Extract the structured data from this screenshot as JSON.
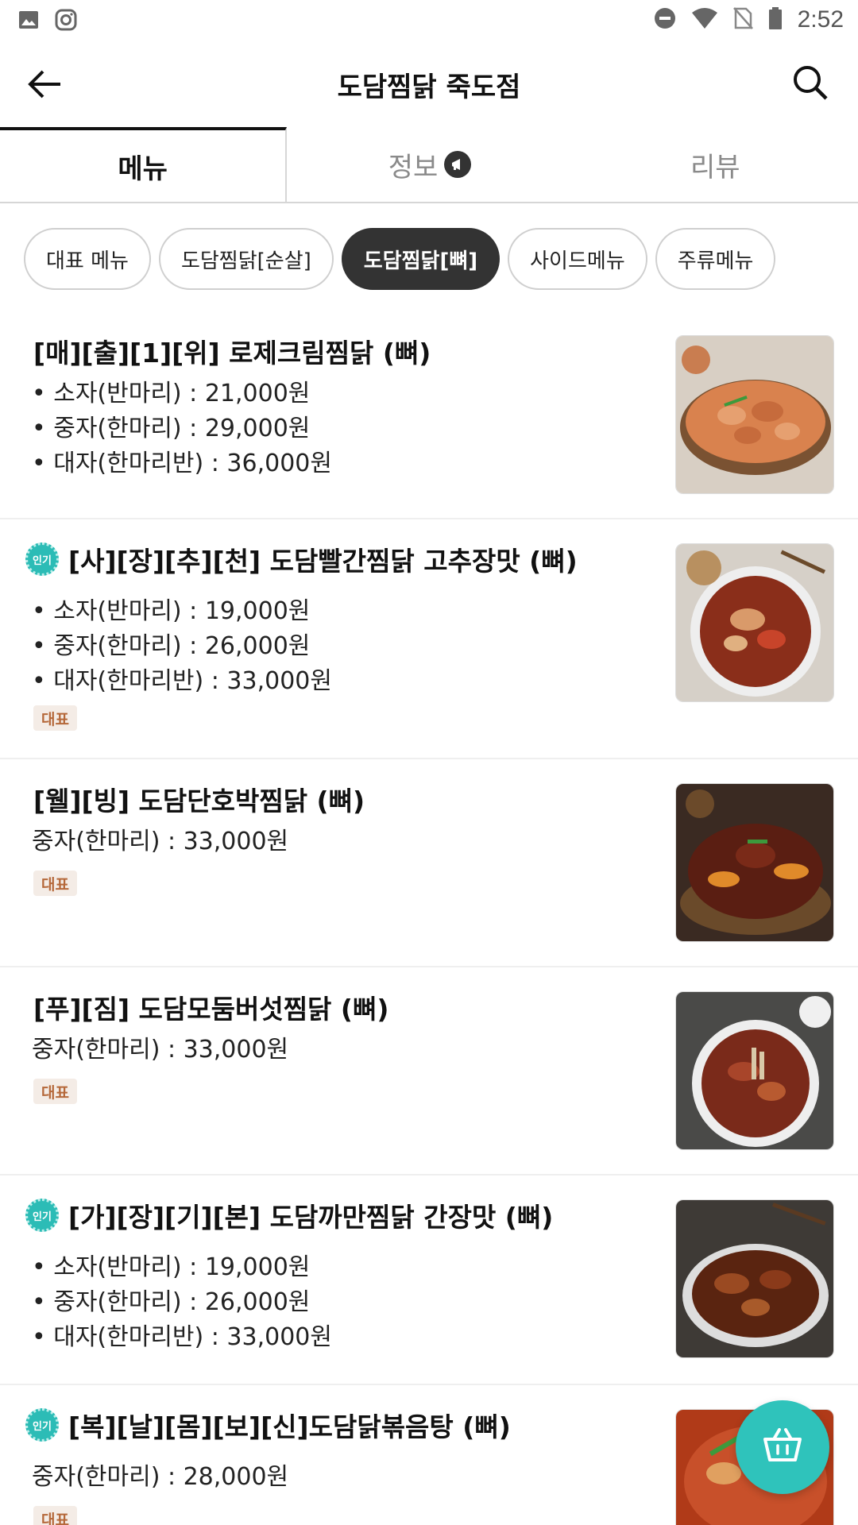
{
  "status_bar": {
    "time": "2:52",
    "left_icons": [
      "image-icon",
      "instagram-icon"
    ],
    "right_icons": [
      "dnd-icon",
      "wifi-icon",
      "no-sim-icon",
      "battery-icon"
    ]
  },
  "app_bar": {
    "title": "도담찜닭 죽도점",
    "back_icon": "arrow-left-icon",
    "search_icon": "search-icon"
  },
  "tabs": [
    {
      "label": "메뉴",
      "active": true
    },
    {
      "label": "정보",
      "active": false,
      "badge_icon": "megaphone-icon"
    },
    {
      "label": "리뷰",
      "active": false
    }
  ],
  "chips": [
    {
      "label": "대표 메뉴",
      "active": false
    },
    {
      "label": "도담찜닭[순살]",
      "active": false
    },
    {
      "label": "도담찜닭[뼈]",
      "active": true
    },
    {
      "label": "사이드메뉴",
      "active": false
    },
    {
      "label": "주류메뉴",
      "active": false
    }
  ],
  "menu_items": [
    {
      "title": "[매][출][1][위] 로제크림찜닭 (뼈)",
      "popular": false,
      "prices": [
        "• 소자(반마리) : 21,000원",
        "• 중자(한마리) : 29,000원",
        "• 대자(한마리반) : 36,000원"
      ],
      "tag": ""
    },
    {
      "title": "[사][장][추][천] 도담빨간찜닭 고추장맛 (뼈)",
      "popular": true,
      "popular_label": "인기",
      "prices": [
        "• 소자(반마리) : 19,000원",
        "• 중자(한마리) : 26,000원",
        "• 대자(한마리반) : 33,000원"
      ],
      "tag": "대표"
    },
    {
      "title": "[웰][빙] 도담단호박찜닭 (뼈)",
      "popular": false,
      "prices": [
        "중자(한마리) : 33,000원"
      ],
      "tag": "대표"
    },
    {
      "title": "[푸][짐] 도담모둠버섯찜닭 (뼈)",
      "popular": false,
      "prices": [
        "중자(한마리) : 33,000원"
      ],
      "tag": "대표"
    },
    {
      "title": "[가][장][기][본] 도담까만찜닭 간장맛 (뼈)",
      "popular": true,
      "popular_label": "인기",
      "prices": [
        "• 소자(반마리) : 19,000원",
        "• 중자(한마리) : 26,000원",
        "• 대자(한마리반) : 33,000원"
      ],
      "tag": ""
    },
    {
      "title": "[복][날][몸][보][신]도담닭볶음탕 (뼈)",
      "popular": true,
      "popular_label": "인기",
      "prices": [
        "중자(한마리) : 28,000원"
      ],
      "tag": "대표"
    }
  ],
  "cart_icon": "basket-icon",
  "colors": {
    "accent_teal": "#2fc3bb",
    "chip_active_bg": "#333333",
    "tag_bg": "#f4ece6",
    "tag_text": "#b5683a"
  }
}
